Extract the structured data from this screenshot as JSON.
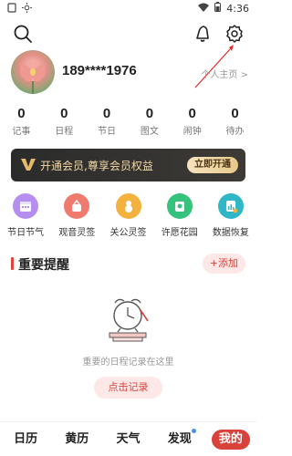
{
  "status_bar": {
    "time": "4:36",
    "icons": [
      "notification-icon",
      "brightness-icon",
      "wifi-icon",
      "battery-icon"
    ]
  },
  "header": {
    "icons": [
      "search-icon",
      "bell-icon",
      "gear-icon"
    ]
  },
  "profile": {
    "phone": "189****1976",
    "home_link": "个人主页 >"
  },
  "stats": [
    {
      "num": "0",
      "label": "记事"
    },
    {
      "num": "0",
      "label": "日程"
    },
    {
      "num": "0",
      "label": "节日"
    },
    {
      "num": "0",
      "label": "图文"
    },
    {
      "num": "0",
      "label": "闹钟"
    },
    {
      "num": "0",
      "label": "待办"
    }
  ],
  "vip": {
    "text": "开通会员,尊享会员权益",
    "button": "立即开通"
  },
  "quick_links": [
    {
      "label": "节日节气",
      "icon": "calendar-icon",
      "color": "#b58ef0"
    },
    {
      "label": "观音灵签",
      "icon": "lotus-icon",
      "color": "#f07a6e"
    },
    {
      "label": "关公灵签",
      "icon": "gourd-icon",
      "color": "#f3b13e"
    },
    {
      "label": "许愿花园",
      "icon": "wish-icon",
      "color": "#35c27c"
    },
    {
      "label": "数据恢复",
      "icon": "restore-icon",
      "color": "#2fb7c7"
    }
  ],
  "reminder": {
    "title": "重要提醒",
    "add": "+添加",
    "empty_text": "重要的日程记录在这里",
    "record_button": "点击记录"
  },
  "tabs": [
    {
      "label": "日历",
      "active": false
    },
    {
      "label": "黄历",
      "active": false
    },
    {
      "label": "天气",
      "active": false
    },
    {
      "label": "发现",
      "active": false,
      "dot": true
    },
    {
      "label": "我的",
      "active": true
    }
  ]
}
